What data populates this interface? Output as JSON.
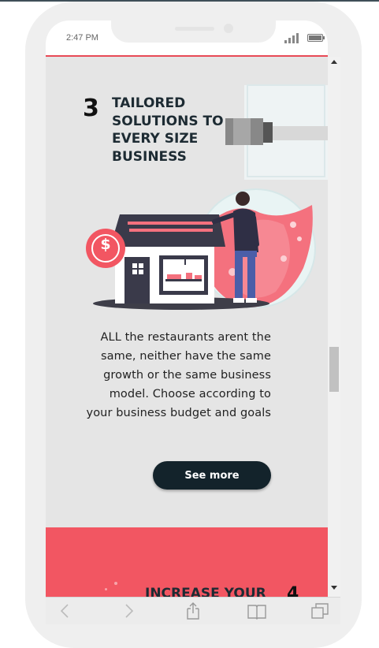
{
  "status_bar": {
    "time": "2:47 PM"
  },
  "section": {
    "number": "3",
    "title_lines": [
      "TAILORED",
      "SOLUTIONS TO",
      "EVERY SIZE",
      "BUSINESS"
    ],
    "illustration_icon": "dollar-icon",
    "illustration_symbol": "$",
    "body_lines": [
      "ALL the restaurants arent the",
      "same, neither have the same",
      "growth or the same business",
      "model. Choose according to",
      "your business budget and goals"
    ],
    "button_label": "See more"
  },
  "next_section": {
    "title": "INCREASE YOUR",
    "number": "4"
  },
  "toolbar": {
    "icons": [
      "back-icon",
      "forward-icon",
      "share-icon",
      "bookmarks-icon",
      "tabs-icon"
    ]
  },
  "colors": {
    "accent": "#f25662",
    "dark": "#13232b",
    "background": "#e5e5e5"
  }
}
